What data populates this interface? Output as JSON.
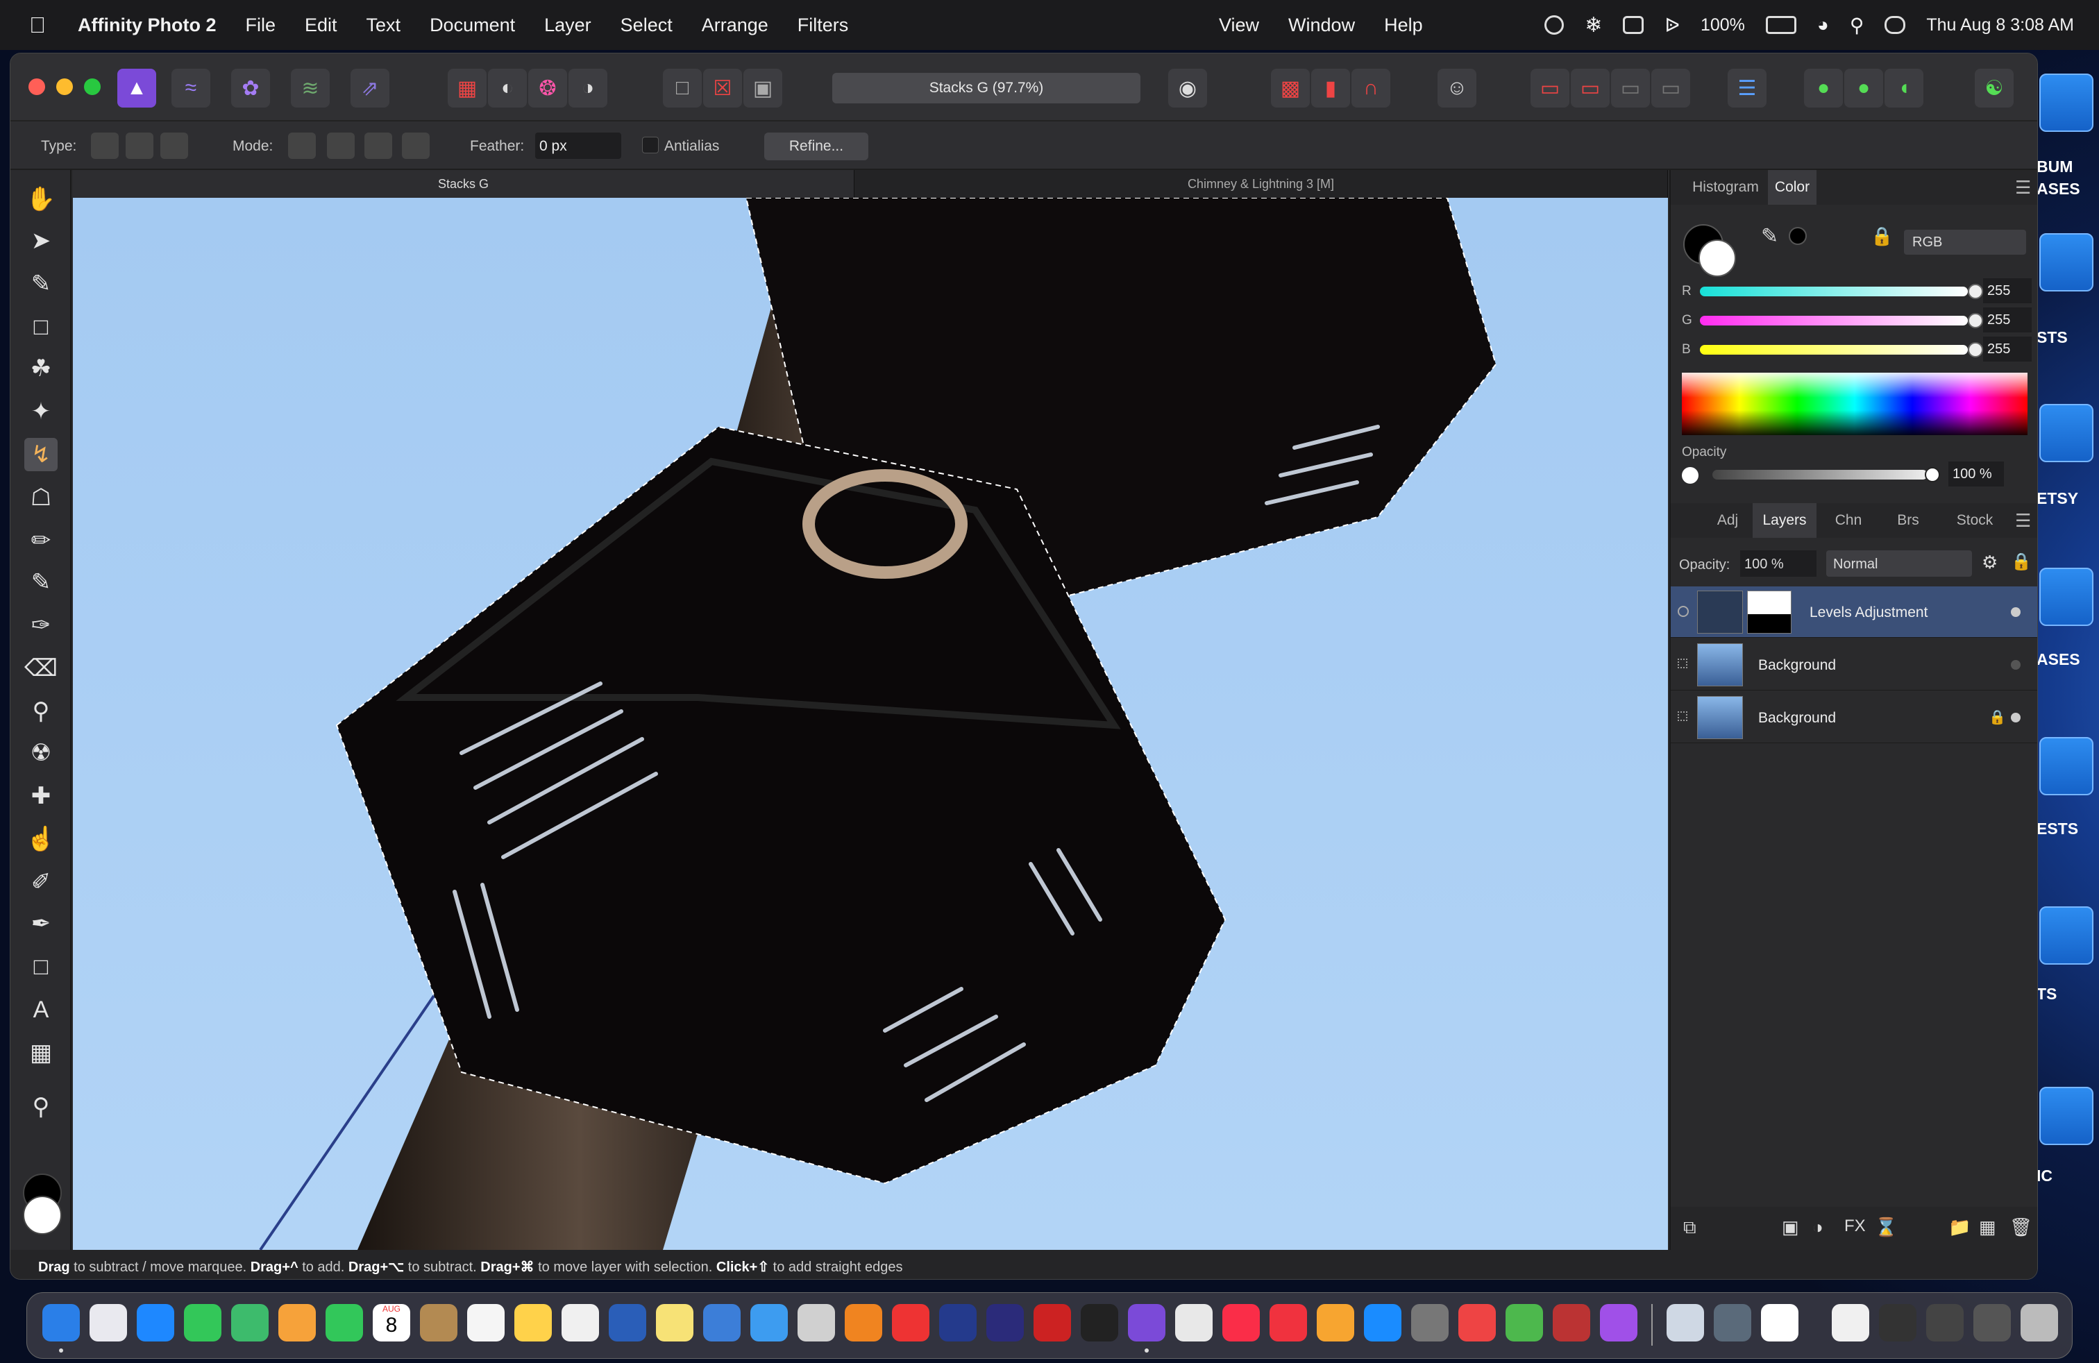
{
  "menubar": {
    "app_name": "Affinity Photo 2",
    "menus": [
      "File",
      "Edit",
      "Text",
      "Document",
      "Layer",
      "Select",
      "Arrange",
      "Filters"
    ],
    "menus_right": [
      "View",
      "Window",
      "Help"
    ],
    "battery": "100%",
    "datetime": "Thu Aug 8  3:08 AM"
  },
  "toolbar": {
    "document_title": "Stacks G (97.7%)",
    "personas": [
      "photo-persona",
      "liquify-persona",
      "develop-persona",
      "tone-mapping-persona",
      "export-persona"
    ]
  },
  "context": {
    "type_label": "Type:",
    "mode_label": "Mode:",
    "feather_label": "Feather:",
    "feather_value": "0 px",
    "antialias_label": "Antialias",
    "refine_label": "Refine..."
  },
  "doc_tabs": [
    {
      "label": "Stacks G",
      "active": true
    },
    {
      "label": "Chimney & Lightning 3 [M]",
      "active": false
    }
  ],
  "color_panel": {
    "tabs": [
      "Histogram",
      "Color"
    ],
    "active_tab": "Color",
    "model": "RGB",
    "channels": [
      {
        "label": "R",
        "value": "255",
        "gradient": "#18e0d8,#ffffff"
      },
      {
        "label": "G",
        "value": "255",
        "gradient": "#ff2cf0,#ffffff"
      },
      {
        "label": "B",
        "value": "255",
        "gradient": "#ffff10,#ffffff"
      }
    ],
    "opacity_label": "Opacity",
    "opacity_value": "100 %"
  },
  "layers_panel": {
    "tabs": [
      "Adj",
      "Layers",
      "Chn",
      "Brs",
      "Stock"
    ],
    "active_tab": "Layers",
    "opacity_label": "Opacity:",
    "opacity_value": "100 %",
    "blend_mode": "Normal",
    "layers": [
      {
        "name": "Levels Adjustment",
        "selected": true,
        "locked": false
      },
      {
        "name": "Background",
        "selected": false,
        "locked": false
      },
      {
        "name": "Background",
        "selected": false,
        "locked": true
      }
    ]
  },
  "statusbar": {
    "k1": "Drag",
    "t1": " to subtract / move marquee. ",
    "k2": "Drag+^",
    "t2": " to add. ",
    "k3": "Drag+⌥",
    "t3": " to subtract. ",
    "k4": "Drag+⌘",
    "t4": " to move layer with selection. ",
    "k5": "Click+⇧",
    "t5": " to add straight edges"
  },
  "desktop_labels": [
    "BUM\nASES",
    "STS",
    "ETSY",
    "ASES",
    "ESTS",
    "TS",
    "IC"
  ],
  "dock_calendar": {
    "month": "AUG",
    "day": "8"
  }
}
